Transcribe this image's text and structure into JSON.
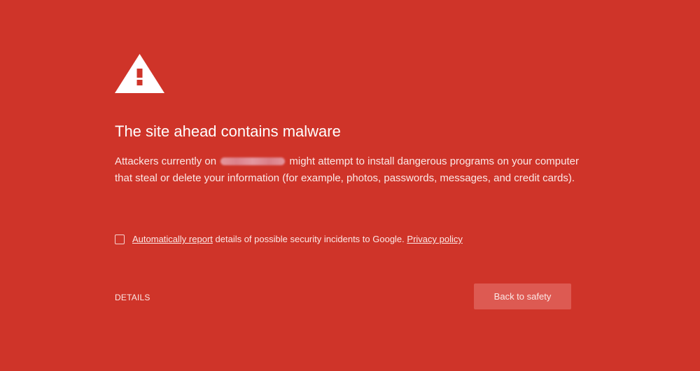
{
  "page": {
    "background_color": "#cf3429",
    "icon": "warning-triangle-icon"
  },
  "main": {
    "title": "The site ahead contains malware",
    "explanation": {
      "before": "Attackers currently on",
      "domain": "[redacted site name]",
      "after": "might attempt to install dangerous programs on your computer that steal or delete your information (for example, photos, passwords, messages, and credit cards)."
    },
    "report": {
      "checked": false,
      "link_text": "Automatically report",
      "text": "details of possible security incidents to Google.",
      "privacy_link": "Privacy policy"
    }
  },
  "footer": {
    "details_label": "DETAILS",
    "primary_button_label": "Back to safety",
    "primary_button_color": "#dd5a52"
  }
}
